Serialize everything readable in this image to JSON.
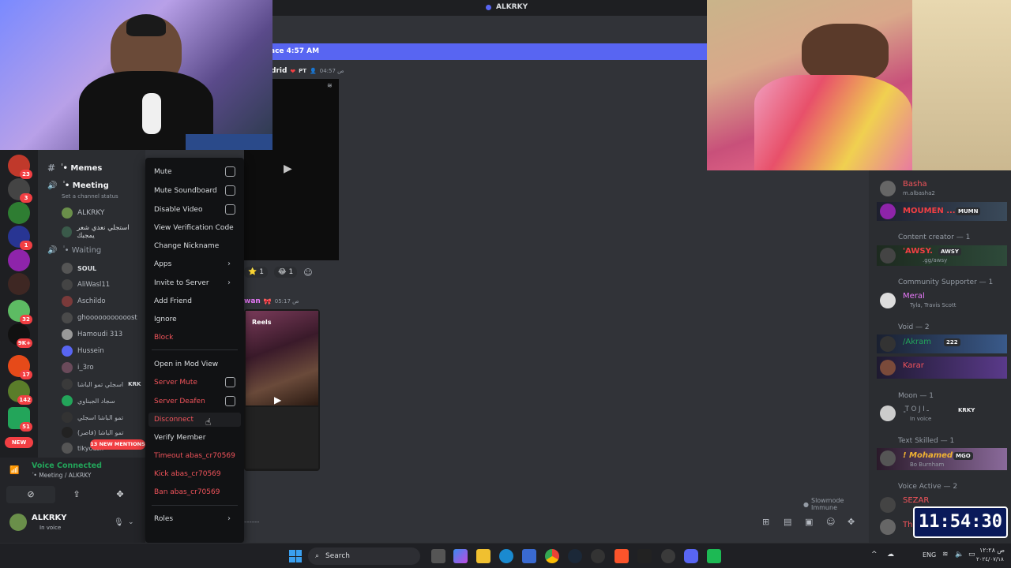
{
  "window": {
    "title": "ALKRKY"
  },
  "banner": {
    "text": "ace 4:57 AM",
    "color": "#5865f2"
  },
  "messages": [
    {
      "author": "drid",
      "tag": "PT",
      "time": "04:57 ص"
    },
    {
      "author": "wan",
      "time": "05:17 ص"
    }
  ],
  "reactions": [
    {
      "emoji": "⭐",
      "count": "1"
    },
    {
      "emoji": "😂",
      "count": "1"
    }
  ],
  "thumb_text": {
    "reels": "Reels"
  },
  "channels": {
    "memes": "ٰ • Memes",
    "meeting": "ٰ • Meeting",
    "set_status": "Set a channel status",
    "waiting": "ٰ • Waiting",
    "meeting_users": [
      "ALKRKY",
      "استجلي نعدي شعر يمجبك"
    ],
    "waiting_users": [
      "SOUL",
      "AliWasl11",
      "Aschildo",
      "ghooooooooooost",
      "Hamoudi 313",
      "Hussein",
      "i_3ro",
      "اسجلي تمو الباشا",
      "سجاد الجبناوي",
      "تمو الباشا اسجلي",
      "(قاصر) تمو الباشا",
      "tikyousif"
    ],
    "krky_tag": "KRK",
    "new_mentions": "13 NEW MENTIONS"
  },
  "servers": [
    {
      "badge": "23"
    },
    {
      "badge": "3"
    },
    {
      "badge": ""
    },
    {
      "badge": "1"
    },
    {
      "badge": ""
    },
    {
      "badge": ""
    },
    {
      "badge": "32"
    },
    {
      "badge": "9K+"
    },
    {
      "badge": "17"
    },
    {
      "badge": "142"
    },
    {
      "badge": "51"
    },
    {
      "badge": "NEW"
    }
  ],
  "voice": {
    "status": "Voice Connected",
    "channel": "ٰ • Meeting / ALKRKY"
  },
  "user": {
    "name": "ALKRKY",
    "status": "In voice"
  },
  "context_menu": {
    "items": [
      {
        "label": "Mute",
        "check": true
      },
      {
        "label": "Mute Soundboard",
        "check": true
      },
      {
        "label": "Disable Video",
        "check": true
      },
      {
        "label": "View Verification Code"
      },
      {
        "label": "Change Nickname"
      },
      {
        "label": "Apps",
        "arrow": true
      },
      {
        "label": "Invite to Server",
        "arrow": true
      },
      {
        "label": "Add Friend"
      },
      {
        "label": "Ignore"
      },
      {
        "label": "Block",
        "danger": true
      },
      {
        "label": "Open in Mod View"
      },
      {
        "label": "Server Mute",
        "danger": true,
        "check": true
      },
      {
        "label": "Server Deafen",
        "danger": true,
        "check": true
      },
      {
        "label": "Disconnect",
        "danger": true
      },
      {
        "label": "Verify Member"
      },
      {
        "label": "Timeout abas_cr70569",
        "danger": true
      },
      {
        "label": "Kick abas_cr70569",
        "danger": true
      },
      {
        "label": "Ban abas_cr70569",
        "danger": true
      },
      {
        "label": "Roles",
        "arrow": true
      }
    ]
  },
  "members": {
    "basha": {
      "name": "Basha",
      "sub": "m.albasha2"
    },
    "moumen": {
      "name": "MOUMEN ...",
      "tag": "MUMN"
    },
    "roles": [
      "Content creator — 1",
      "Community Supporter — 1",
      "Void — 2",
      "Moon — 1",
      "Text Skilled — 1",
      "Voice Active — 2"
    ],
    "awsy": {
      "name": "'AWSY.",
      "tag": "AWSY",
      "sub": ".gg/awsy"
    },
    "meral": {
      "name": "Meral",
      "sub": "Tyla, Travis Scott"
    },
    "akram": {
      "name": "/Akram",
      "tag": "222"
    },
    "karar": {
      "name": "Karar"
    },
    "moon_user": {
      "name": "ٍ T O J I ـ",
      "tag": "KRKY",
      "sub": "In voice"
    },
    "mohamed": {
      "name": "! Mohamed",
      "tag": "MGO",
      "sub": "Bo Burnham"
    },
    "sezar": {
      "name": "SEZAR"
    },
    "the": {
      "name": "The"
    }
  },
  "slowmode": "Slowmode Immune",
  "clock_overlay": "11:54:30",
  "taskbar": {
    "search": "Search",
    "lang": "ENG",
    "time": "ص ١٢:٢٨",
    "date": "٢٠٢٤/٠٧/١٨"
  }
}
